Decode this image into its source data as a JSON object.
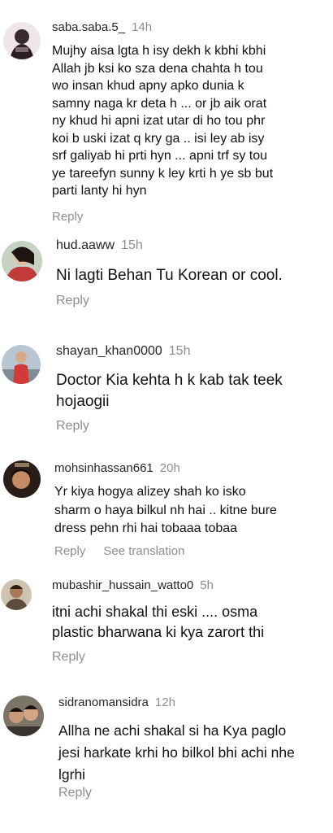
{
  "comments": [
    {
      "username": "saba.saba.5_",
      "time": "14h",
      "text": "Mujhy aisa lgta h isy dekh k kbhi kbhi\nAllah jb ksi ko sza dena chahta h tou\nwo insan khud apny apko dunia k\nsamny naga kr deta h ... or jb aik orat\nny khud hi apni izat utar di ho tou phr\nkoi b uski izat q kry ga .. isi ley ab isy\nsrf galiyab hi prti hyn ... apni trf sy tou\nye tareefyn sunny k ley krti h ye sb but\nparti lanty hi hyn",
      "reply": "Reply",
      "avatar_color": "#d8c7cf"
    },
    {
      "username": "hud.aaww",
      "time": "15h",
      "text": "Ni lagti Behan Tu Korean or cool.",
      "reply": "Reply",
      "avatar_color": "#b33a3a"
    },
    {
      "username": "shayan_khan0000",
      "time": "15h",
      "text": "Doctor Kia kehta h k kab tak teek\nhojaogii",
      "reply": "Reply",
      "avatar_color": "#9aa7b4"
    },
    {
      "username": "mohsinhassan661",
      "time": "20h",
      "text": "Yr kiya hogya alizey shah ko isko\nsharm o haya bilkul nh hai .. kitne bure\ndress pehn rhi hai tobaaa tobaa",
      "reply": "Reply",
      "see_translation": "See translation",
      "avatar_color": "#3a2b22"
    },
    {
      "username": "mubashir_hussain_watto0",
      "time": "5h",
      "text": "itni achi shakal thi eski .... osma\nplastic bharwana ki kya zarort thi",
      "reply": "Reply",
      "avatar_color": "#6b5a48"
    },
    {
      "username": "sidranomansidra",
      "time": "12h",
      "text": "Allha ne achi shakal si ha Kya paglo\njesi harkate krhi ho bilkol bhi achi nhe\nlgrhi",
      "reply": "Reply",
      "avatar_color": "#4a4038"
    }
  ]
}
